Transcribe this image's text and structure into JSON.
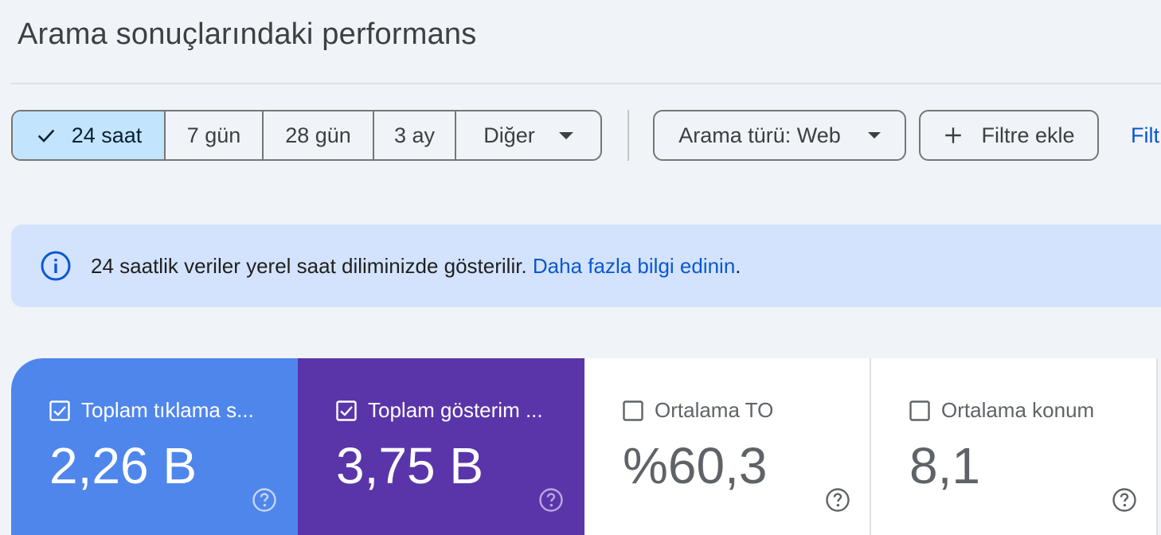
{
  "page": {
    "title": "Arama sonuçlarındaki performans"
  },
  "date_range": {
    "options": [
      {
        "label": "24 saat",
        "selected": true
      },
      {
        "label": "7 gün",
        "selected": false
      },
      {
        "label": "28 gün",
        "selected": false
      },
      {
        "label": "3 ay",
        "selected": false
      },
      {
        "label": "Diğer",
        "selected": false
      }
    ]
  },
  "filters": {
    "search_type": "Arama türü: Web",
    "add_filter": "Filtre ekle",
    "reset_truncated": "Filt"
  },
  "info_banner": {
    "text": "24 saatlik veriler yerel saat diliminizde gösterilir.",
    "link": "Daha fazla bilgi edinin",
    "suffix": "."
  },
  "metrics": [
    {
      "label": "Toplam tıklama s...",
      "value": "2,26 B",
      "checked": true,
      "color": "#4f86ec"
    },
    {
      "label": "Toplam gösterim ...",
      "value": "3,75 B",
      "checked": true,
      "color": "#5a35a9"
    },
    {
      "label": "Ortalama TO",
      "value": "%60,3",
      "checked": false,
      "color": "#ffffff"
    },
    {
      "label": "Ortalama konum",
      "value": "8,1",
      "checked": false,
      "color": "#ffffff"
    }
  ],
  "icons": {
    "check": "check-icon",
    "caret": "arrow-drop-down-icon",
    "plus": "plus-icon",
    "info": "info-icon",
    "help": "help-icon",
    "checkbox_checked": "checkbox-checked-icon",
    "checkbox_unchecked": "checkbox-unchecked-icon"
  }
}
